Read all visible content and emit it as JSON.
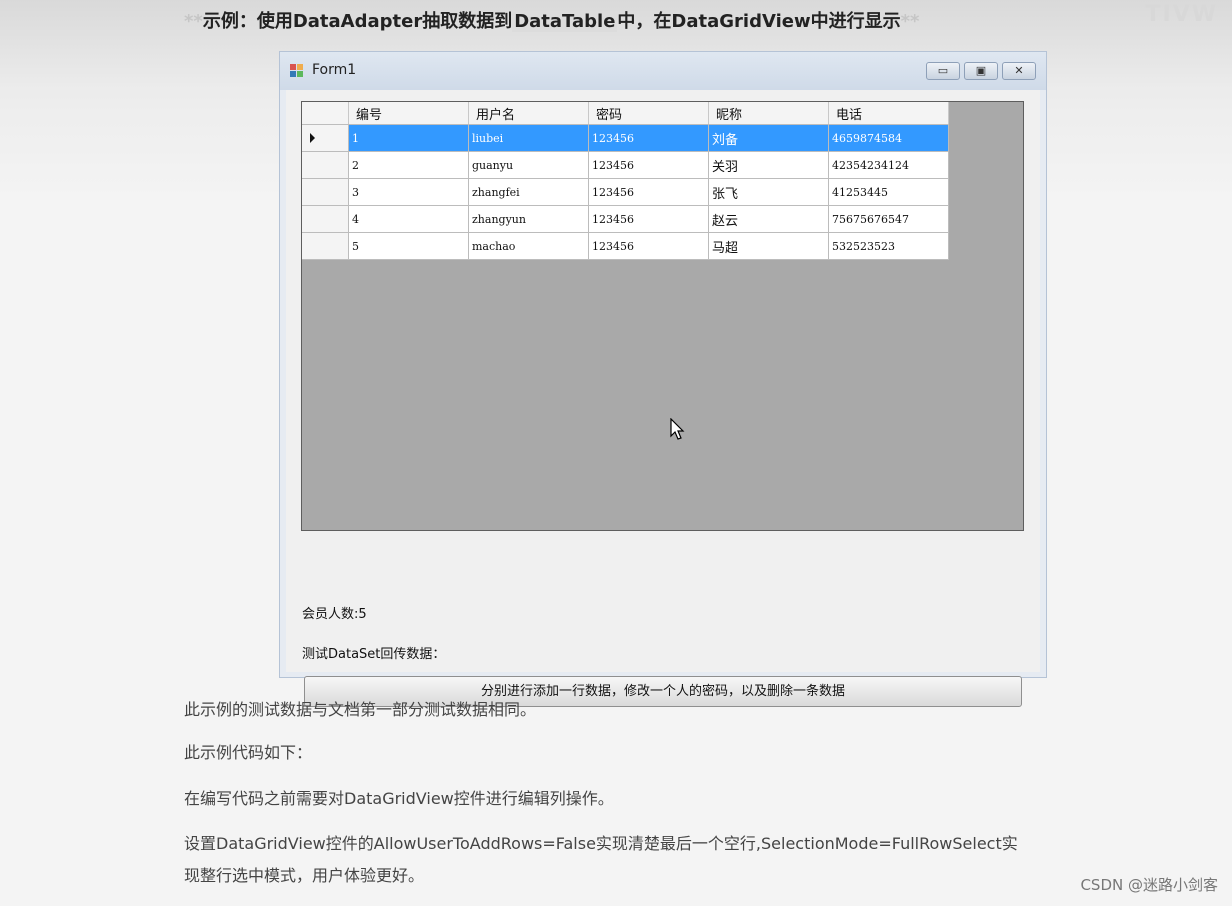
{
  "heading": {
    "stars_open": "**",
    "part1": "示例：使用DataAdapter抽取数据到",
    "highlight": "DataTable",
    "part2": "中，在DataGridView中进行显示",
    "stars_close": "**"
  },
  "corner_text": "TIVW",
  "window": {
    "title": "Form1",
    "minimize_glyph": "▭",
    "maximize_glyph": "▣",
    "close_glyph": "✕"
  },
  "grid": {
    "columns": [
      "编号",
      "用户名",
      "密码",
      "昵称",
      "电话"
    ],
    "selected_row": 0,
    "rows": [
      [
        "1",
        "liubei",
        "123456",
        "刘备",
        "4659874584"
      ],
      [
        "2",
        "guanyu",
        "123456",
        "关羽",
        "42354234124"
      ],
      [
        "3",
        "zhangfei",
        "123456",
        "张飞",
        "41253445"
      ],
      [
        "4",
        "zhangyun",
        "123456",
        "赵云",
        "75675676547"
      ],
      [
        "5",
        "machao",
        "123456",
        "马超",
        "532523523"
      ]
    ]
  },
  "member_count": "会员人数:5",
  "test_label": "测试DataSet回传数据：",
  "action_button": "分别进行添加一行数据，修改一个人的密码，以及删除一条数据",
  "paragraphs": [
    "此示例的测试数据与文档第一部分测试数据相同。",
    "此示例代码如下：",
    "在编写代码之前需要对DataGridView控件进行编辑列操作。",
    "设置DataGridView控件的AllowUserToAddRows=False实现清楚最后一个空行,SelectionMode=FullRowSelect实",
    "现整行选中模式，用户体验更好。"
  ],
  "watermark": "CSDN @迷路小剑客",
  "colors": {
    "selection": "#3399ff",
    "grid_background": "#a9a9a9",
    "titlebar": "#d6e0ec"
  }
}
